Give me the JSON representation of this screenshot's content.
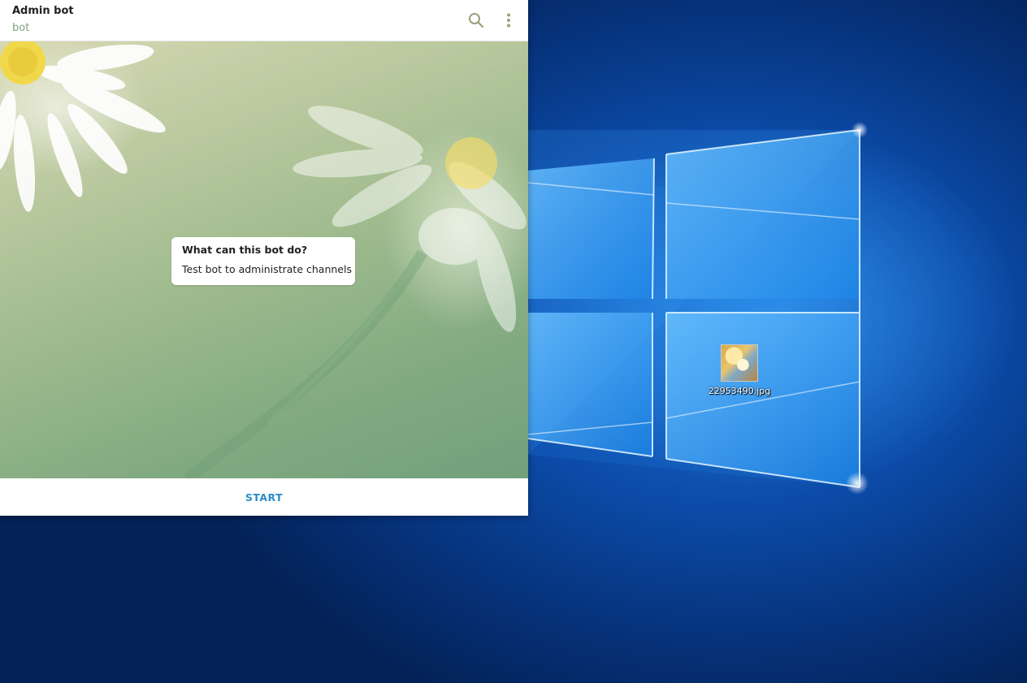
{
  "chat": {
    "title": "Admin bot",
    "subtitle": "bot",
    "header_icons": [
      "search-icon",
      "more-vertical-icon"
    ],
    "bot_info": {
      "heading": "What can this bot do?",
      "description": "Test bot to administrate channels"
    },
    "start_label": "START"
  },
  "desktop": {
    "icons": [
      {
        "label": "22953490.jpg",
        "type": "image-file-icon"
      }
    ]
  },
  "colors": {
    "subtitle": "#7fa57f",
    "start": "#2c8bc7",
    "header_icon": "#9aa07e",
    "desktop_blue": "#0b4aa6"
  }
}
